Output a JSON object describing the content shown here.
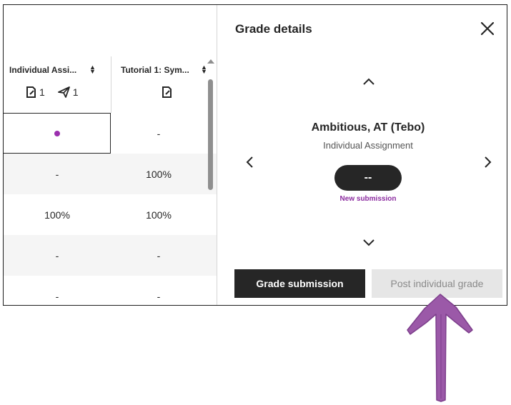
{
  "grid": {
    "columns": [
      {
        "title": "Individual Assi...",
        "needs_grading": "1",
        "submitted": "1"
      },
      {
        "title": "Tutorial 1: Sym..."
      }
    ],
    "rows": [
      {
        "col1": "",
        "col2": "-"
      },
      {
        "col1": "-",
        "col2": "100%"
      },
      {
        "col1": "100%",
        "col2": "100%"
      },
      {
        "col1": "-",
        "col2": "-"
      },
      {
        "col1": "-",
        "col2": "-"
      }
    ],
    "selected_cell_status": "new-submission-dot"
  },
  "panel": {
    "title": "Grade details",
    "student_name": "Ambitious, AT (Tebo)",
    "assignment": "Individual Assignment",
    "grade_value": "--",
    "status": "New submission",
    "grade_button": "Grade submission",
    "post_button": "Post individual grade"
  },
  "colors": {
    "accent_purple": "#8b2a9f",
    "dark": "#262626",
    "annotation_arrow": "#9b59a8"
  }
}
